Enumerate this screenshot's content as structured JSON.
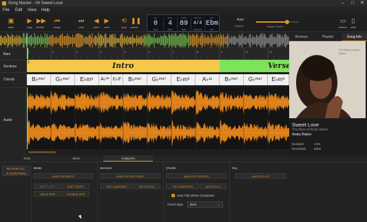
{
  "window": {
    "title": "Song Master - 04 Sweet Love"
  },
  "menu": [
    "File",
    "Edit",
    "View",
    "Help"
  ],
  "toolbar": {
    "buttons": [
      {
        "label": "save",
        "icon": "save-icon"
      },
      {
        "label": "play",
        "icon": "play-icon"
      },
      {
        "label": "fwd/all",
        "icon": "forward-icon"
      },
      {
        "label": "begin",
        "icon": "begin-icon"
      },
      {
        "label": "next",
        "icon": "next-icon"
      },
      {
        "label": "prev",
        "icon": "prev-icon"
      },
      {
        "label": "next",
        "icon": "next-icon"
      },
      {
        "label": "loop",
        "icon": "loop-icon"
      },
      {
        "label": "pause",
        "icon": "pause-icon"
      }
    ],
    "lcd": [
      {
        "top": "Bar",
        "val": "0",
        "bot": "BAR"
      },
      {
        "top": "BEAT",
        "val": "4",
        "bot": "BEAT"
      },
      {
        "top": "BPM",
        "val": "89",
        "bot": "BPM"
      },
      {
        "top": "TIME SIG",
        "val": "4/4",
        "bot": "TIME SIG"
      },
      {
        "top": "KEY",
        "val": "Ebm",
        "bot": "KEY"
      }
    ],
    "auto_label": "Auto",
    "analysis_label": "analysis",
    "volume_label": "Master Volume",
    "volume_level": 0.72,
    "right_labels": [
      "bottom",
      "slide"
    ]
  },
  "lanes": {
    "labels": [
      "Bars",
      "Sections",
      "Chords",
      "Audio"
    ],
    "bar_numbers": [
      "1",
      "2",
      "3",
      "4",
      "5",
      "6",
      "7",
      "8",
      "9",
      "10",
      "11"
    ],
    "sections": [
      {
        "name": "Intro",
        "color": "#f4c94a"
      },
      {
        "name": "Verse",
        "color": "#7ee25a"
      }
    ],
    "section_start_number": "3",
    "chords": [
      "Bbma7",
      "Gbma7",
      "Ebm9",
      "Ab11",
      "Eb/F",
      "Bbma7",
      "Gbma7",
      "Ebm9",
      "Ab11",
      "Bbma7",
      "Gbma7",
      "Ebm9"
    ]
  },
  "bottom_tabs": [
    "Tools",
    "Mixer",
    "Analyzers"
  ],
  "analyzers": {
    "rerun_label": "RE-RUN ALL ALGORITHMS",
    "beats": {
      "title": "Beats",
      "analyze": "ANALYZE BEATS",
      "shift_left": "SHIFT LEFT",
      "shift_right": "SHIFT RIGHT",
      "half": "HALVE BPM",
      "double": "DOUBLE BPM"
    },
    "sections": {
      "title": "Sections",
      "analyze": "ANALYZE SECTIONS",
      "tidy": "TIDY MARKERS",
      "delete": "DELETE ALL"
    },
    "chords": {
      "title": "Chords",
      "analyze": "ANALYZE CHORDS",
      "tidy": "TIDY MARKERS",
      "delete": "DELETE ALL",
      "auto_tidy": "Auto Tidy When Computed",
      "algo_label": "Chord Algo:",
      "algo_value": "Best"
    },
    "key": {
      "title": "Key",
      "analyze": "ANALYZE KEY"
    }
  },
  "right_pane": {
    "tabs": [
      "Browser",
      "Playlist",
      "Song Info"
    ],
    "cover_text": "The Best of Anita Baker",
    "song_title": "Sweet Love",
    "album": "The Best of Anita Baker",
    "artist": "Anita Baker",
    "duration_label": "Duration:",
    "duration": "4:26",
    "recorded_label": "Recorded:",
    "recorded": "2002"
  },
  "colors": {
    "accent": "#e0952b",
    "intro": "#f4c94a",
    "verse": "#7ee25a",
    "wave": "#e8861a"
  }
}
